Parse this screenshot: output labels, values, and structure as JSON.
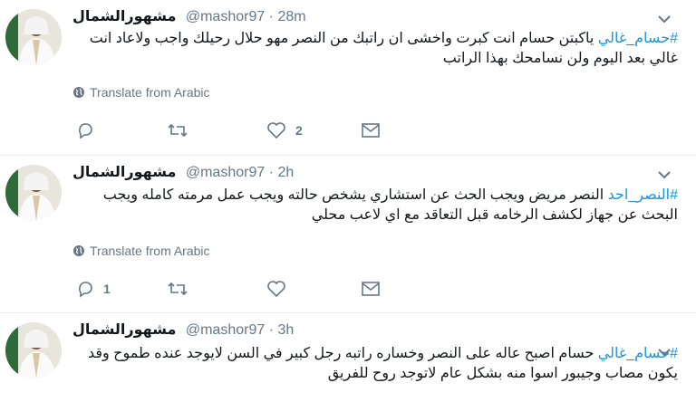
{
  "colors": {
    "accent": "#1b95e0",
    "muted": "#657786",
    "text": "#14171a",
    "divider": "#e6ecf0"
  },
  "icons": [
    "avatar-photo",
    "chevron-down-icon",
    "globe-icon",
    "reply-icon",
    "retweet-icon",
    "like-icon",
    "message-icon"
  ],
  "tweets": [
    {
      "name": "مشهورالشمال",
      "handle": "@mashor97",
      "sep": " · ",
      "time": "28m",
      "hashtag": "#حسام_غالي",
      "text": " ياكبتن حسام انت كبرت واخشى ان راتبك من النصر مهو حلال رحيلك واجب  ولاعاد انت غالي بعد اليوم ولن نسامحك بهذا الراتب",
      "translate": "Translate from Arabic",
      "reply_count": "",
      "like_count": "2"
    },
    {
      "name": "مشهورالشمال",
      "handle": "@mashor97",
      "sep": " · ",
      "time": "2h",
      "hashtag": "#النصر_احد",
      "text": " النصر مريض ويجب الحث عن استشاري يشخص حالته ويجب عمل مرمته كامله ويجب البحث عن جهاز لكشف الرخامه قبل التعاقد مع اي لاعب محلي",
      "translate": "Translate from Arabic",
      "reply_count": "1",
      "like_count": ""
    },
    {
      "name": "مشهورالشمال",
      "handle": "@mashor97",
      "sep": " · ",
      "time": "3h",
      "hashtag": "#حسام_غالي",
      "text": " حسام اصبح عاله على النصر وخساره راتبه رجل كبير في السن لايوجد عنده طموح وقد يكون مصاب وجيبور اسوا منه  بشكل عام لاتوجد روح للفريق"
    }
  ]
}
